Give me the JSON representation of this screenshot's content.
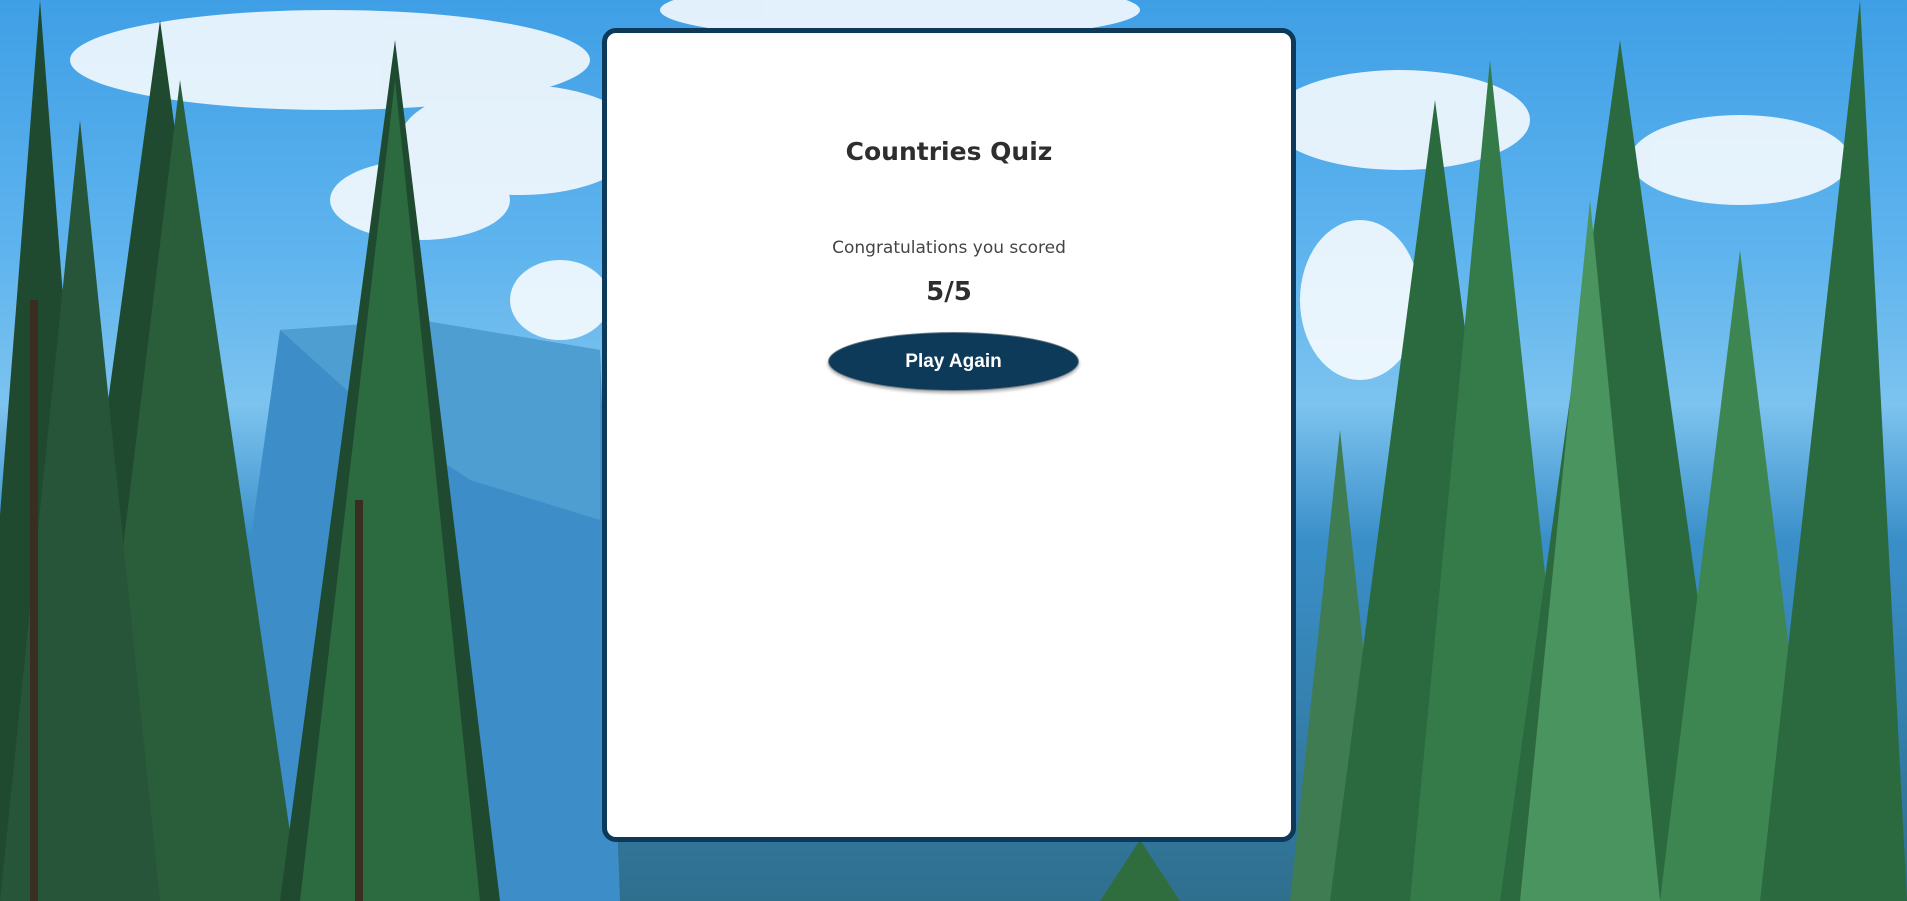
{
  "quiz": {
    "title": "Countries Quiz",
    "message": "Congratulations you scored",
    "score": "5/5",
    "play_again_label": "Play Again"
  },
  "colors": {
    "card_border": "#0e3a5a",
    "button_background": "#0e3a5a",
    "button_text": "#ffffff",
    "title_text": "#2e2e2e"
  },
  "background": {
    "depicts": [
      "sky",
      "clouds",
      "mountain",
      "pine-trees"
    ]
  }
}
